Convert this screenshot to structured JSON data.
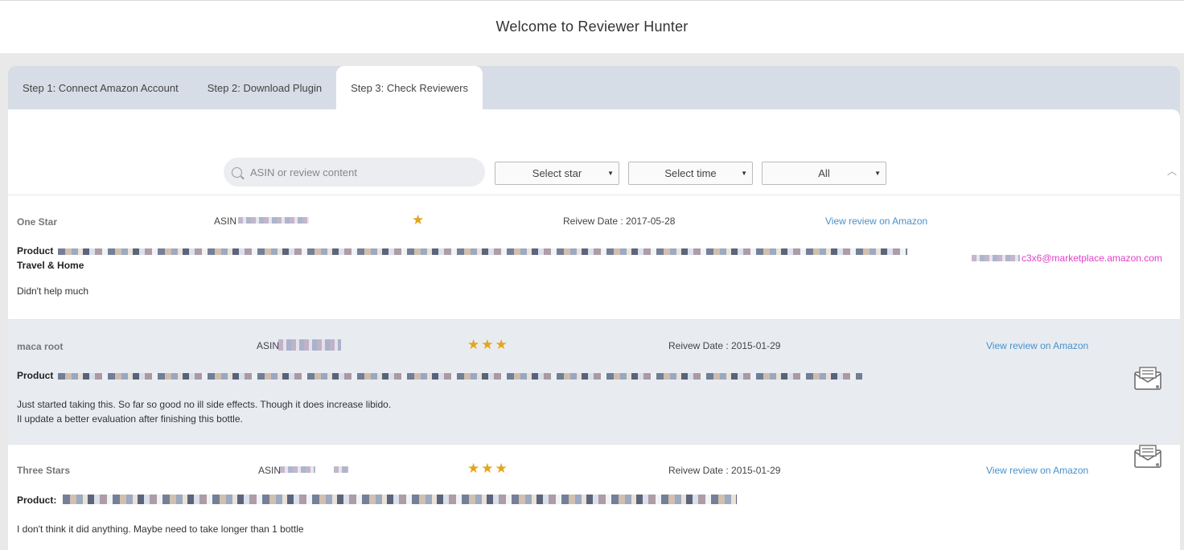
{
  "header": {
    "title": "Welcome to Reviewer Hunter"
  },
  "tabs": [
    {
      "label": "Step 1: Connect Amazon Account",
      "active": false
    },
    {
      "label": "Step 2: Download Plugin",
      "active": false
    },
    {
      "label": "Step 3: Check Reviewers",
      "active": true
    }
  ],
  "filters": {
    "search_placeholder": "ASIN or review content",
    "star_select": "Select star",
    "time_select": "Select time",
    "type_select": "All"
  },
  "colors": {
    "link": "#4a90c8",
    "star": "#e3a51d",
    "email": "#e040c8",
    "alt_row": "#e8ecf1"
  },
  "reviews": [
    {
      "title": "One Star",
      "asin_label": "ASIN",
      "stars": "★",
      "date": "Reivew Date : 2017-05-28",
      "link": "View review on Amazon",
      "product_label": "Product",
      "category": "Travel & Home",
      "body": "Didn't help much",
      "email": "c3x6@marketplace.amazon.com"
    },
    {
      "title": "maca root",
      "asin_label": "ASIN",
      "stars": "★★★",
      "date": "Reivew Date : 2015-01-29",
      "link": "View review on Amazon",
      "product_label": "Product",
      "body_line1": "Just started taking this. So far so good no ill side effects. Though it does increase libido.",
      "body_line2": "Il update a better evaluation after finishing this bottle."
    },
    {
      "title": "Three Stars",
      "asin_label": "ASIN",
      "stars": "★★★",
      "date": "Reivew Date : 2015-01-29",
      "link": "View review on Amazon",
      "product_label": "Product:",
      "body": "I don't think it did anything. Maybe need to take longer than 1 bottle"
    }
  ]
}
